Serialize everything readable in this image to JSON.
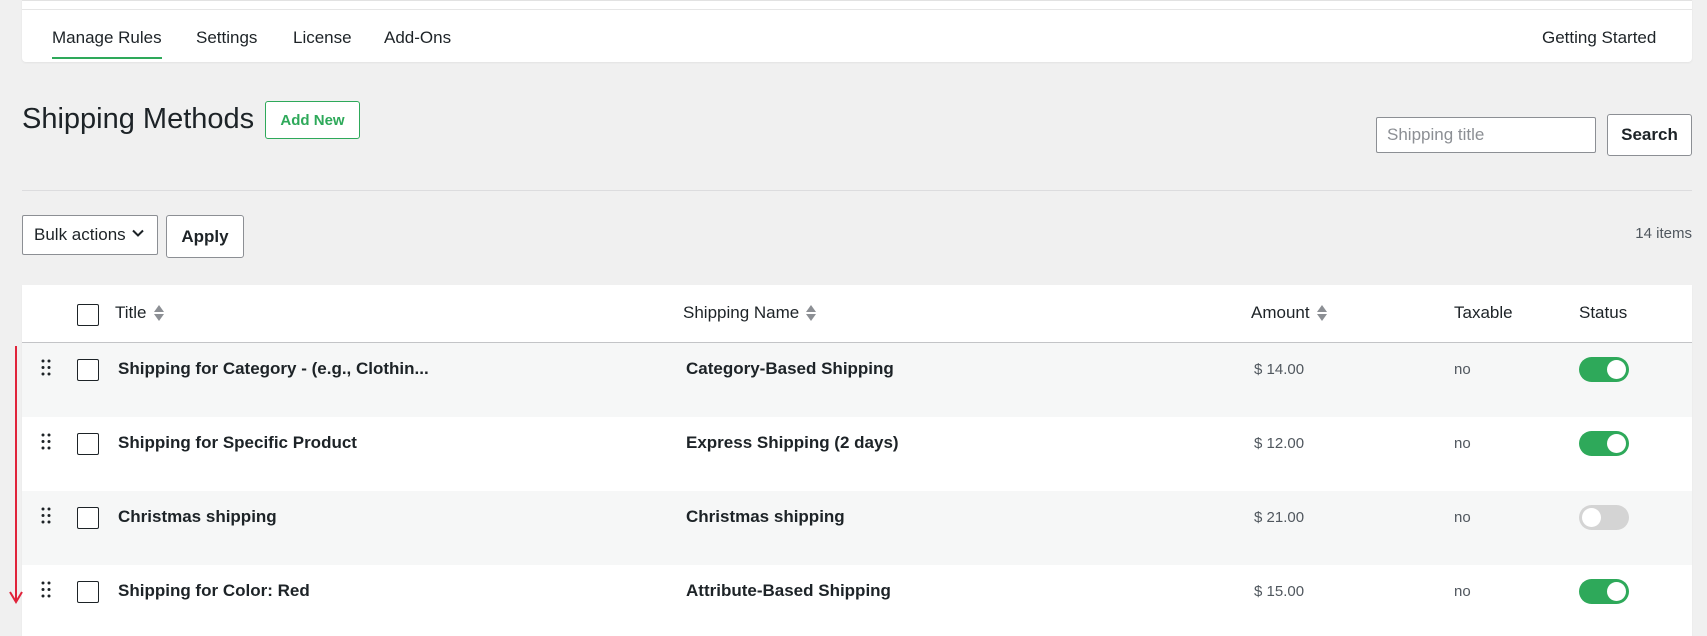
{
  "nav": {
    "tabs": [
      "Manage Rules",
      "Settings",
      "License",
      "Add-Ons"
    ],
    "active_tab": "Manage Rules",
    "getting_started": "Getting Started"
  },
  "page": {
    "title": "Shipping Methods",
    "add_new": "Add New"
  },
  "search": {
    "placeholder": "Shipping title",
    "button": "Search"
  },
  "bulk": {
    "select_value": "Bulk actions",
    "apply": "Apply",
    "items_count": "14 items"
  },
  "table": {
    "columns": {
      "title": "Title",
      "shipping_name": "Shipping Name",
      "amount": "Amount",
      "taxable": "Taxable",
      "status": "Status"
    },
    "rows": [
      {
        "title": "Shipping for Category - (e.g., Clothin...",
        "shipping_name": "Category-Based Shipping",
        "amount": "$ 14.00",
        "taxable": "no",
        "status_on": true
      },
      {
        "title": "Shipping for Specific Product",
        "shipping_name": "Express Shipping (2 days)",
        "amount": "$ 12.00",
        "taxable": "no",
        "status_on": true
      },
      {
        "title": "Christmas shipping",
        "shipping_name": "Christmas shipping",
        "amount": "$ 21.00",
        "taxable": "no",
        "status_on": false
      },
      {
        "title": "Shipping for Color: Red",
        "shipping_name": "Attribute-Based Shipping",
        "amount": "$ 15.00",
        "taxable": "no",
        "status_on": true
      }
    ]
  },
  "colors": {
    "accent": "#2ea95a",
    "toggle_off": "#d4d4d4",
    "annotation_arrow": "#e0233a"
  }
}
